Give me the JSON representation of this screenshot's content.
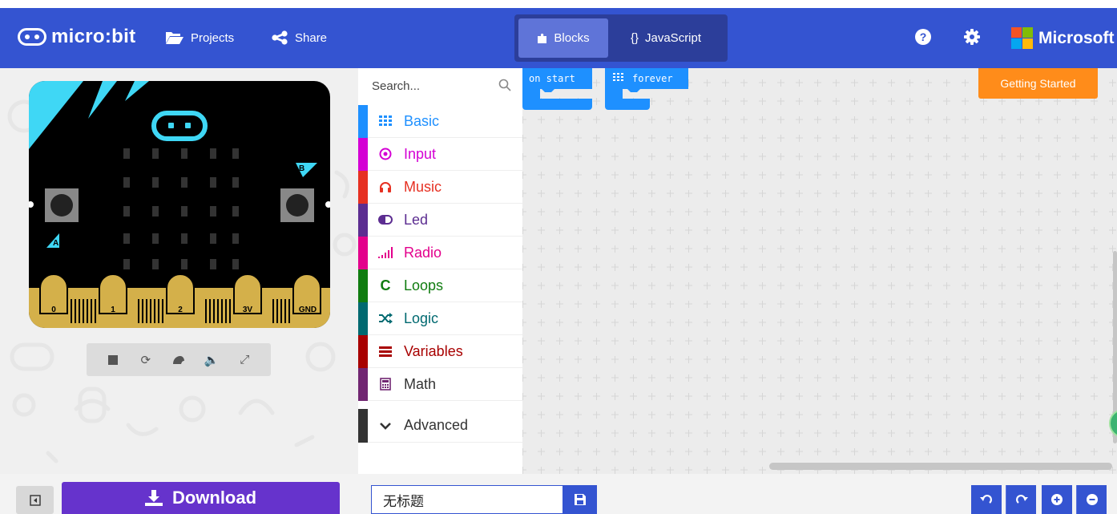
{
  "header": {
    "logo_text": "micro:bit",
    "projects_label": "Projects",
    "share_label": "Share",
    "editor_toggle": {
      "blocks_label": "Blocks",
      "javascript_label": "JavaScript"
    },
    "brand": "Microsoft",
    "icons": [
      "help-icon",
      "gear-icon"
    ]
  },
  "simulator": {
    "pins": [
      "0",
      "1",
      "2",
      "3V",
      "GND"
    ],
    "button_a": "A",
    "button_b": "B",
    "controls": [
      "stop-icon",
      "restart-icon",
      "slowmo-icon",
      "mute-icon",
      "fullscreen-icon"
    ]
  },
  "toolbox": {
    "search_placeholder": "Search...",
    "categories": [
      {
        "label": "Basic",
        "color": "#1e90ff",
        "icon": "grid-icon"
      },
      {
        "label": "Input",
        "color": "#d400d4",
        "icon": "radio-target-icon"
      },
      {
        "label": "Music",
        "color": "#e63022",
        "icon": "headphones-icon"
      },
      {
        "label": "Led",
        "color": "#5c2d91",
        "icon": "toggle-icon"
      },
      {
        "label": "Radio",
        "color": "#e3008c",
        "icon": "signal-icon"
      },
      {
        "label": "Loops",
        "color": "#107c10",
        "icon": "loop-icon"
      },
      {
        "label": "Logic",
        "color": "#006970",
        "icon": "shuffle-icon"
      },
      {
        "label": "Variables",
        "color": "#a80000",
        "icon": "list-icon"
      },
      {
        "label": "Math",
        "color": "#712672",
        "icon": "calculator-icon"
      }
    ],
    "advanced_label": "Advanced"
  },
  "workspace": {
    "blocks": [
      {
        "label": "on start"
      },
      {
        "label": "forever"
      }
    ],
    "getting_started": "Getting Started"
  },
  "bottom": {
    "download_label": "Download",
    "project_name": "无标题"
  }
}
